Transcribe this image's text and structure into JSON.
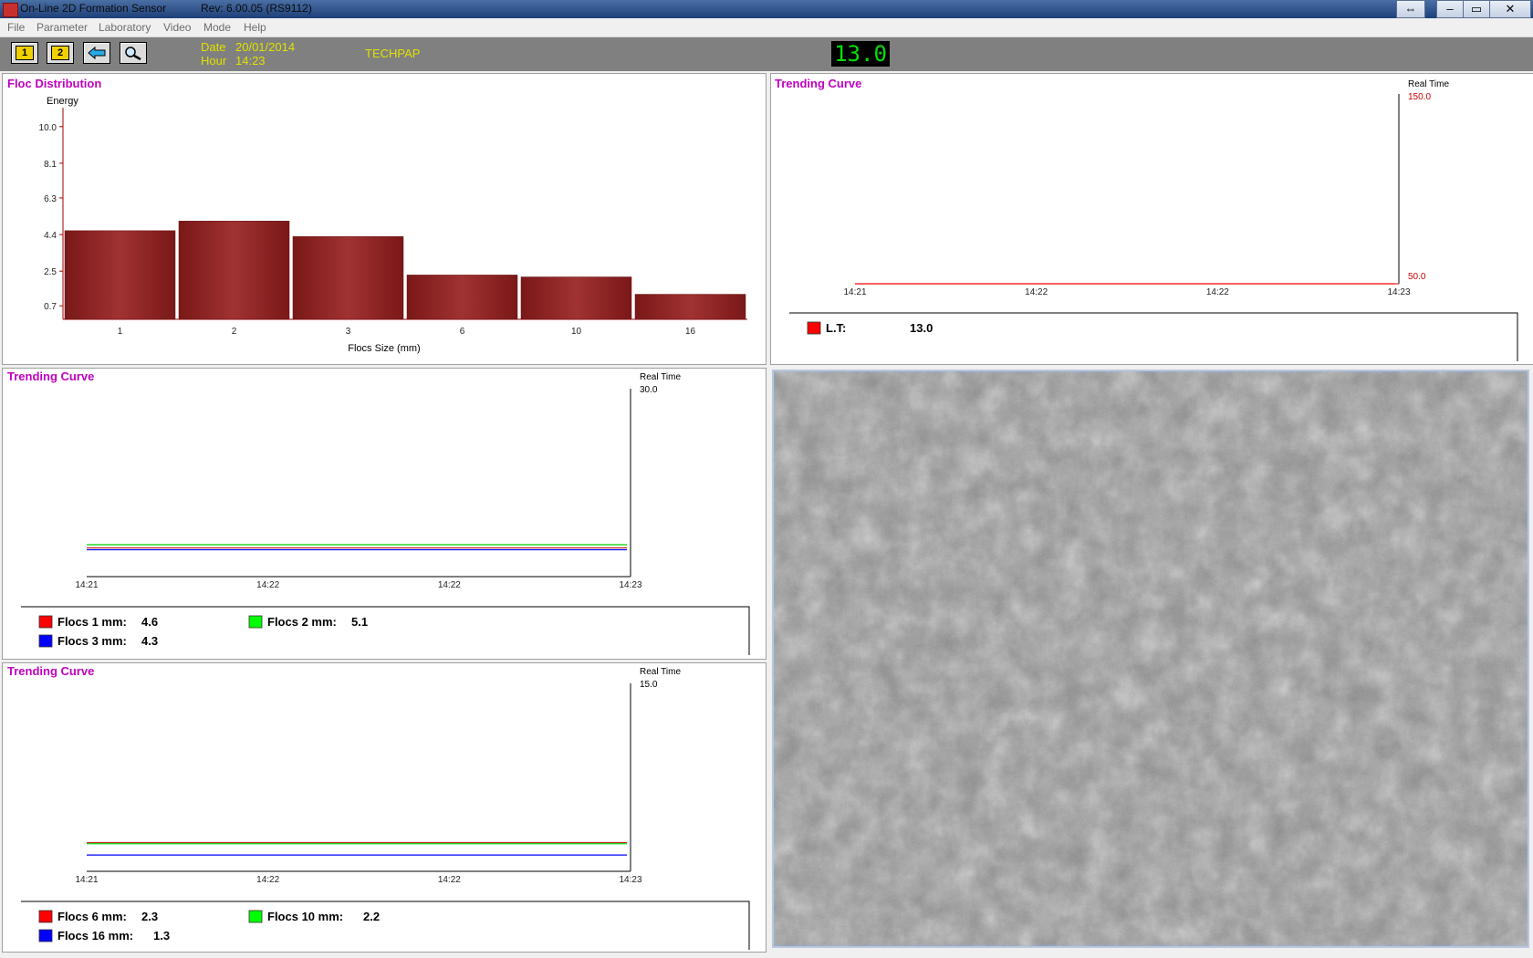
{
  "window": {
    "title": "On-Line 2D Formation Sensor",
    "rev": "Rev: 6.00.05 (RS9112)",
    "buttons": [
      "⇔",
      "–",
      "▭",
      "✕"
    ]
  },
  "menu": [
    "File",
    "Parameter",
    "Laboratory",
    "Video",
    "Mode",
    "Help"
  ],
  "toolbar": {
    "btn1": "1",
    "btn2": "2",
    "date_label": "Date",
    "date_value": "20/01/2014",
    "hour_label": "Hour",
    "hour_value": "14:23",
    "site": "TECHPAP",
    "display_value": "13.0"
  },
  "floc_panel": {
    "title": "Floc Distribution",
    "chart_data": {
      "type": "bar",
      "title": "Floc Distribution",
      "ylabel": "Energy",
      "xlabel": "Flocs Size (mm)",
      "categories": [
        "1",
        "2",
        "3",
        "6",
        "10",
        "16"
      ],
      "values": [
        4.6,
        5.1,
        4.3,
        2.3,
        2.2,
        1.3
      ],
      "yticks": [
        "10.0",
        "8.1",
        "6.3",
        "4.4",
        "2.5",
        "0.7"
      ],
      "ylim": [
        0,
        10.7
      ],
      "bar_color": "#a03232"
    }
  },
  "trend_top": {
    "title": "Trending Curve",
    "rt_label": "Real Time",
    "ymax": "150.0",
    "ymin": "50.0",
    "xticks": [
      "14:21",
      "14:22",
      "14:22",
      "14:23"
    ],
    "legend": [
      {
        "name": "L.T:",
        "value": "13.0",
        "color": "#ff0000"
      }
    ],
    "chart_data": {
      "type": "line",
      "ylim": [
        50,
        150
      ],
      "series": [
        {
          "name": "L.T:",
          "color": "#ff0000",
          "values": [
            50,
            50
          ]
        }
      ]
    }
  },
  "trend_mid": {
    "title": "Trending Curve",
    "rt_label": "Real Time",
    "ymax": "30.0",
    "xticks": [
      "14:21",
      "14:22",
      "14:22",
      "14:23"
    ],
    "legend": [
      {
        "name": "Flocs 1 mm:",
        "value": "4.6",
        "color": "#ff0000"
      },
      {
        "name": "Flocs 2 mm:",
        "value": "5.1",
        "color": "#00ff00"
      },
      {
        "name": "Flocs 3 mm:",
        "value": "4.3",
        "color": "#0000ff"
      }
    ],
    "chart_data": {
      "type": "line",
      "ylim": [
        0,
        30
      ],
      "series": [
        {
          "name": "Flocs 1 mm:",
          "color": "#d02020",
          "values": [
            4.6,
            4.6,
            4.6,
            4.6
          ]
        },
        {
          "name": "Flocs 2 mm:",
          "color": "#00d000",
          "values": [
            5.1,
            5.1,
            5.1,
            5.1
          ]
        },
        {
          "name": "Flocs 3 mm:",
          "color": "#0000ff",
          "values": [
            4.3,
            4.3,
            4.3,
            4.3
          ]
        }
      ]
    }
  },
  "trend_bot": {
    "title": "Trending Curve",
    "rt_label": "Real Time",
    "ymax": "15.0",
    "xticks": [
      "14:21",
      "14:22",
      "14:22",
      "14:23"
    ],
    "legend": [
      {
        "name": "Flocs 6 mm:",
        "value": "2.3",
        "color": "#ff0000"
      },
      {
        "name": "Flocs 10 mm:",
        "value": "2.2",
        "color": "#00ff00"
      },
      {
        "name": "Flocs 16 mm:",
        "value": "1.3",
        "color": "#0000ff"
      }
    ],
    "chart_data": {
      "type": "line",
      "ylim": [
        0,
        15
      ],
      "series": [
        {
          "name": "Flocs 6 mm:",
          "color": "#d02020",
          "values": [
            2.3,
            2.3,
            2.3,
            2.3
          ]
        },
        {
          "name": "Flocs 10 mm:",
          "color": "#00d000",
          "values": [
            2.2,
            2.2,
            2.2,
            2.2
          ]
        },
        {
          "name": "Flocs 16 mm:",
          "color": "#0000ff",
          "values": [
            1.3,
            1.3,
            1.3,
            1.3
          ]
        }
      ]
    }
  }
}
